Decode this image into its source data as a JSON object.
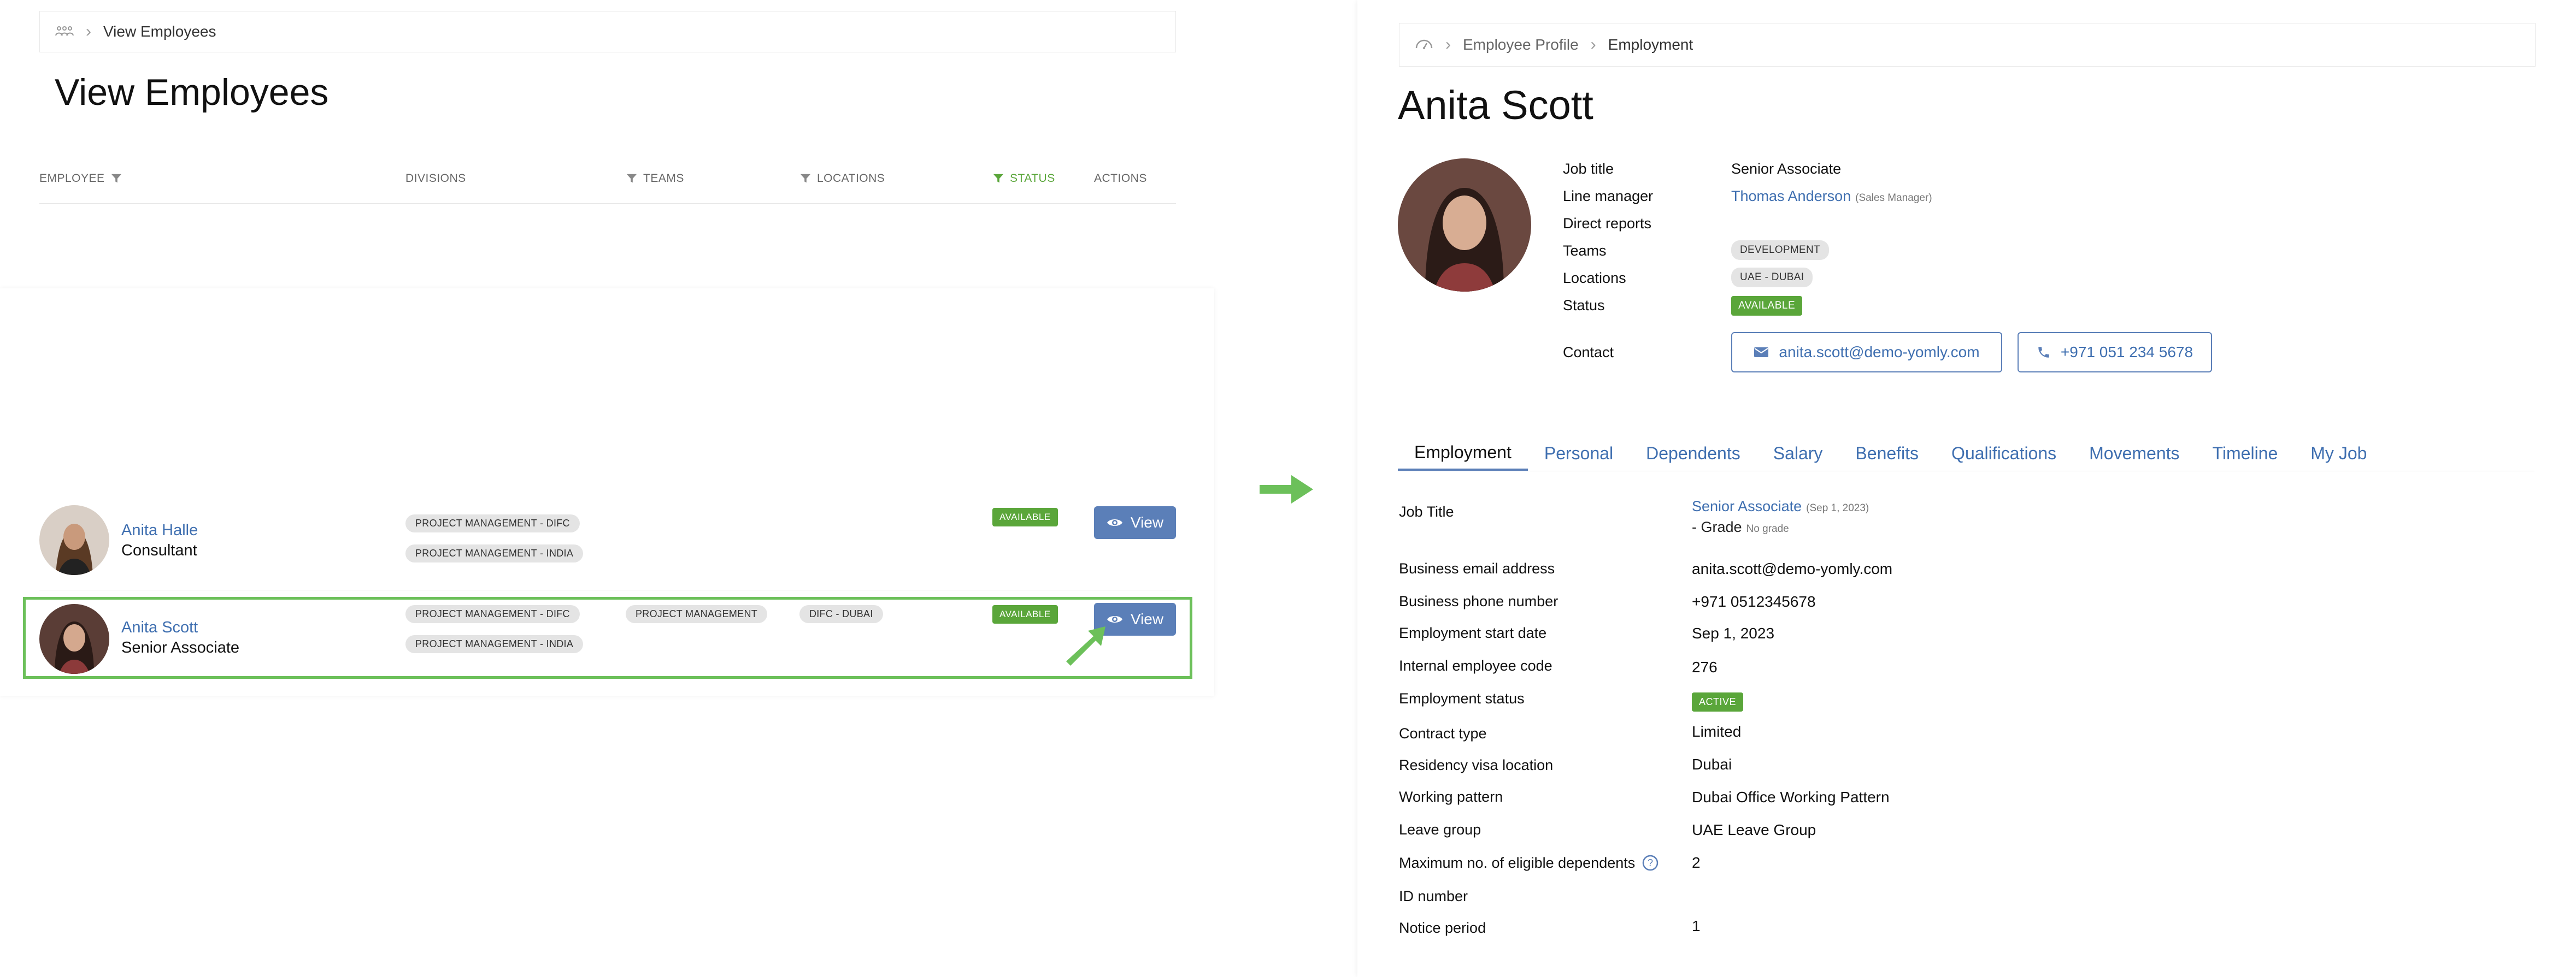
{
  "left": {
    "breadcrumb": {
      "current": "View Employees"
    },
    "title": "View Employees",
    "columns": {
      "employee": "EMPLOYEE",
      "divisions": "DIVISIONS",
      "teams": "TEAMS",
      "locations": "LOCATIONS",
      "status": "STATUS",
      "actions": "ACTIONS"
    },
    "rows": [
      {
        "name": "Anita Halle",
        "role": "Consultant",
        "divisions": [
          "PROJECT MANAGEMENT - DIFC",
          "PROJECT MANAGEMENT - INDIA"
        ],
        "teams": [],
        "locations": [],
        "status": "AVAILABLE",
        "action": "View"
      },
      {
        "name": "Anita Scott",
        "role": "Senior Associate",
        "divisions": [
          "PROJECT MANAGEMENT - DIFC",
          "PROJECT MANAGEMENT - INDIA"
        ],
        "teams": [
          "PROJECT MANAGEMENT"
        ],
        "locations": [
          "DIFC - DUBAI"
        ],
        "status": "AVAILABLE",
        "action": "View"
      }
    ]
  },
  "right": {
    "breadcrumb": {
      "parent": "Employee Profile",
      "current": "Employment"
    },
    "name": "Anita Scott",
    "summary": {
      "job_title_label": "Job title",
      "job_title": "Senior Associate",
      "line_manager_label": "Line manager",
      "line_manager": "Thomas Anderson",
      "line_manager_role": "(Sales Manager)",
      "direct_reports_label": "Direct reports",
      "teams_label": "Teams",
      "teams": "DEVELOPMENT",
      "locations_label": "Locations",
      "locations": "UAE - DUBAI",
      "status_label": "Status",
      "status": "AVAILABLE",
      "contact_label": "Contact",
      "email": "anita.scott@demo-yomly.com",
      "phone": "+971 051 234 5678"
    },
    "tabs": [
      "Employment",
      "Personal",
      "Dependents",
      "Salary",
      "Benefits",
      "Qualifications",
      "Movements",
      "Timeline",
      "My Job"
    ],
    "details": {
      "job_title_label": "Job Title",
      "job_title": "Senior Associate",
      "job_title_date": "(Sep 1, 2023)",
      "grade_prefix": "- Grade",
      "grade": "No grade",
      "rows": [
        {
          "label": "Business email address",
          "value": "anita.scott@demo-yomly.com"
        },
        {
          "label": "Business phone number",
          "value": "+971 0512345678"
        },
        {
          "label": "Employment start date",
          "value": "Sep 1, 2023"
        },
        {
          "label": "Internal employee code",
          "value": "276"
        },
        {
          "label": "Employment status",
          "value": "ACTIVE"
        },
        {
          "label": "Contract type",
          "value": "Limited"
        },
        {
          "label": "Residency visa location",
          "value": "Dubai"
        },
        {
          "label": "Working pattern",
          "value": "Dubai Office Working Pattern"
        },
        {
          "label": "Leave group",
          "value": "UAE Leave Group"
        },
        {
          "label": "Maximum no. of eligible dependents",
          "value": "2"
        },
        {
          "label": "ID number",
          "value": ""
        },
        {
          "label": "Notice period",
          "value": "1"
        }
      ]
    }
  },
  "colors": {
    "accent_blue": "#5b7fb8",
    "link_blue": "#3f6fb0",
    "green": "#5aa63a",
    "highlight_green": "#6cc05a"
  },
  "icons": [
    "home-icon",
    "chevron-right-icon",
    "filter-icon",
    "eye-icon",
    "envelope-icon",
    "phone-icon",
    "help-circle-icon",
    "arrow-right-icon",
    "cursor-arrow-icon"
  ]
}
